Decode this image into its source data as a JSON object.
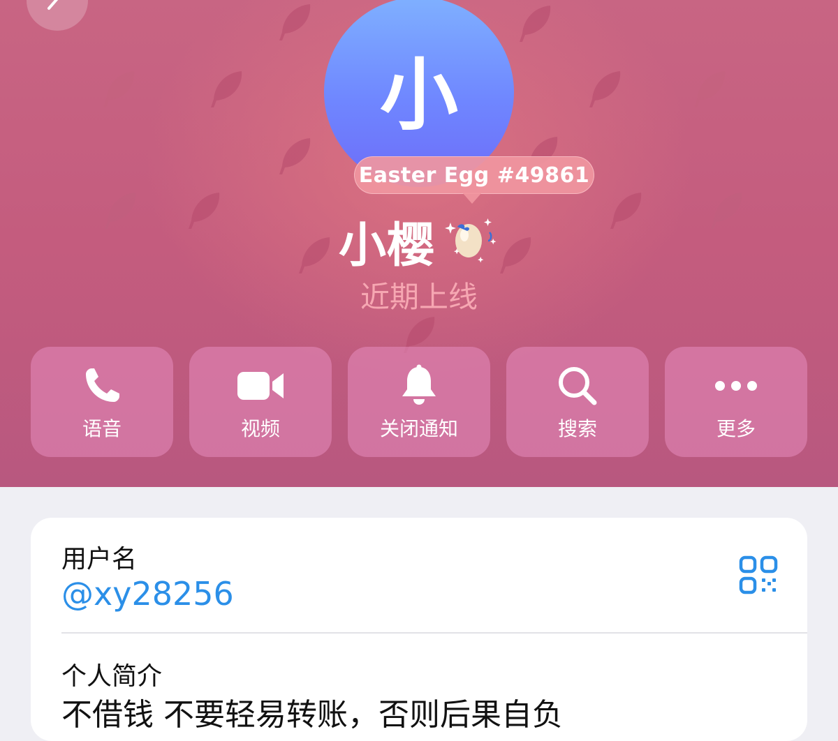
{
  "profile": {
    "avatar_initial": "小",
    "badge_text": "Easter Egg #49861",
    "name": "小樱",
    "status": "近期上线"
  },
  "actions": [
    {
      "label": "语音",
      "icon": "phone-icon"
    },
    {
      "label": "视频",
      "icon": "video-camera-icon"
    },
    {
      "label": "关闭通知",
      "icon": "bell-icon"
    },
    {
      "label": "搜索",
      "icon": "search-icon"
    },
    {
      "label": "更多",
      "icon": "more-dots-icon"
    }
  ],
  "info": {
    "username_label": "用户名",
    "username": "@xy28256",
    "bio_label": "个人简介",
    "bio": "不借钱 不要轻易转账，否则后果自负"
  },
  "colors": {
    "header": "#c45c7e",
    "avatar": "#6f86ff",
    "link": "#2b8fe8",
    "status": "#f6a7b2"
  }
}
